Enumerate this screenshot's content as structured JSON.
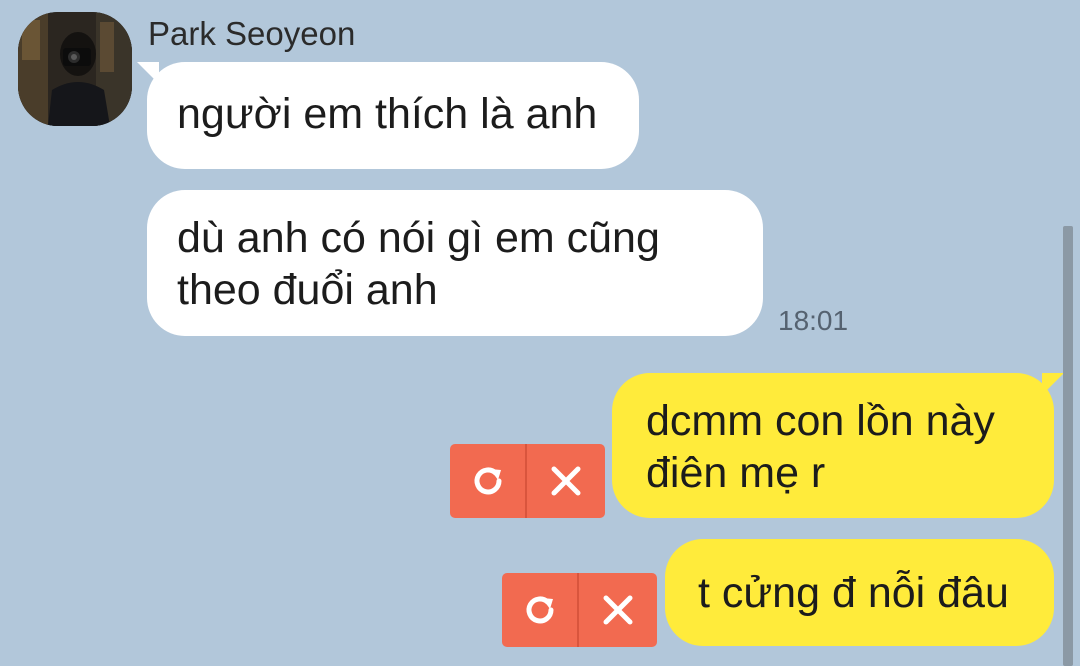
{
  "chat": {
    "sender_name": "Park Seoyeon",
    "incoming": [
      {
        "lines": [
          "người em thích là anh"
        ]
      },
      {
        "lines": [
          "dù anh có nói gì em cũng",
          "theo đuổi anh"
        ]
      }
    ],
    "incoming_time": "18:01",
    "outgoing": [
      {
        "lines": [
          "dcmm con lồn này",
          "điên mẹ r"
        ],
        "status": "failed"
      },
      {
        "lines": [
          "t cửng đ nỗi đâu"
        ],
        "status": "failed"
      }
    ]
  },
  "icons": {
    "retry": "retry-icon",
    "delete": "close-icon"
  },
  "colors": {
    "background": "#b2c7da",
    "incoming_bubble": "#ffffff",
    "outgoing_bubble": "#ffeb3b",
    "failed_action": "#f26a50"
  }
}
